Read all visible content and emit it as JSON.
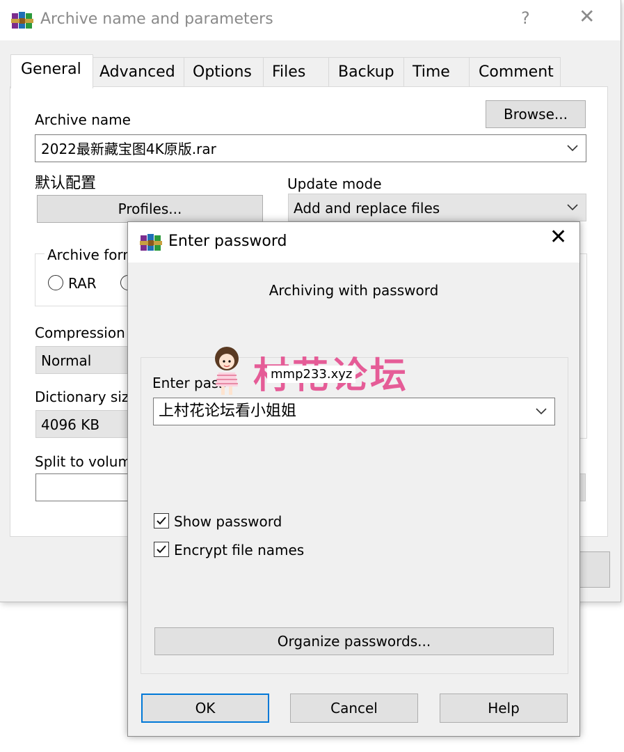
{
  "main_window": {
    "title": "Archive name and parameters",
    "help_glyph": "?",
    "close_glyph": "✕",
    "tabs": [
      {
        "label": "General",
        "active": true
      },
      {
        "label": "Advanced"
      },
      {
        "label": "Options"
      },
      {
        "label": "Files"
      },
      {
        "label": "Backup"
      },
      {
        "label": "Time"
      },
      {
        "label": "Comment"
      }
    ],
    "archive_name_label": "Archive name",
    "browse_label": "Browse...",
    "archive_name_value": "2022最新藏宝图4K原版.rar",
    "profiles_caption": "默认配置",
    "profiles_label": "Profiles...",
    "update_mode_label": "Update mode",
    "update_mode_value": "Add and replace files",
    "archive_format_label": "Archive form",
    "format_rar": "RAR",
    "compression_label": "Compression m",
    "compression_value": "Normal",
    "dictionary_label": "Dictionary size",
    "dictionary_value": "4096 KB",
    "split_label": "Split to volume",
    "split_value": ""
  },
  "password_dialog": {
    "title": "Enter password",
    "close_glyph": "✕",
    "heading": "Archiving with password",
    "enter_password_label": "Enter pass",
    "password_value": "上村花论坛看小姐姐",
    "show_password_label": "Show password",
    "show_password_checked": true,
    "encrypt_names_label": "Encrypt file names",
    "encrypt_names_checked": true,
    "organize_label": "Organize passwords...",
    "ok_label": "OK",
    "cancel_label": "Cancel",
    "help_label": "Help"
  },
  "watermark": {
    "text": "村花论坛",
    "url": "mmp233.xyz"
  },
  "colors": {
    "accent_focus": "#0078d7",
    "watermark_pink": "#e44c8e",
    "titlebar_inactive_text": "#8a8a8a"
  }
}
